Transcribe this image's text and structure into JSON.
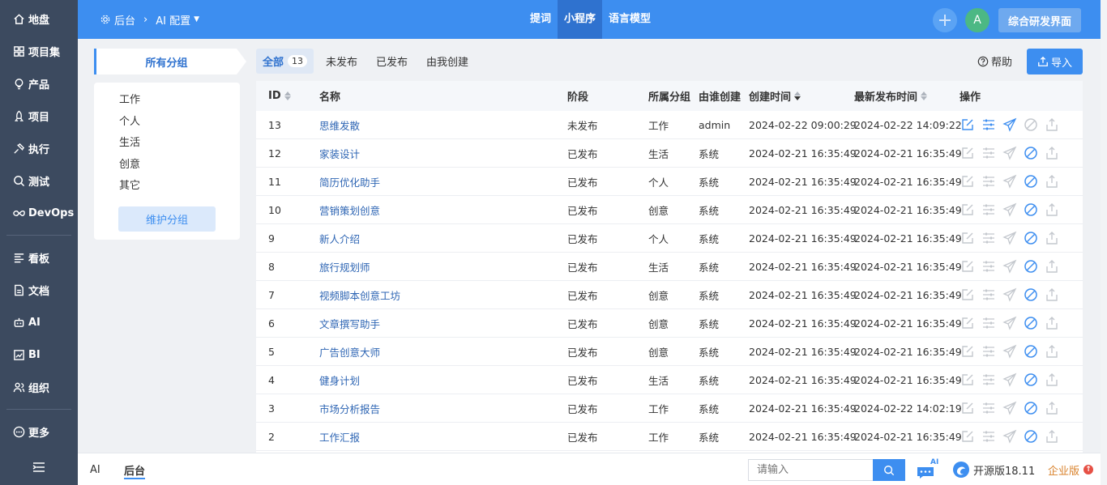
{
  "sidebar": {
    "items": [
      {
        "label": "地盘",
        "icon": "home-icon"
      },
      {
        "label": "项目集",
        "icon": "grid-icon"
      },
      {
        "label": "产品",
        "icon": "lightbulb-icon"
      },
      {
        "label": "项目",
        "icon": "rocket-icon"
      },
      {
        "label": "执行",
        "icon": "execute-icon"
      },
      {
        "label": "测试",
        "icon": "test-icon"
      },
      {
        "label": "DevOps",
        "icon": "infinity-icon"
      }
    ],
    "items2": [
      {
        "label": "看板",
        "icon": "board-icon"
      },
      {
        "label": "文档",
        "icon": "doc-icon"
      },
      {
        "label": "AI",
        "icon": "robot-icon"
      },
      {
        "label": "BI",
        "icon": "chart-icon"
      },
      {
        "label": "组织",
        "icon": "org-icon"
      }
    ],
    "more": "更多"
  },
  "header": {
    "crumb_root": "后台",
    "crumb_current": "AI 配置",
    "tabs": [
      "提词",
      "小程序",
      "语言模型"
    ],
    "active_tab": "小程序",
    "avatar_letter": "A",
    "dev_button": "综合研发界面"
  },
  "groups": {
    "title": "所有分组",
    "items": [
      "工作",
      "个人",
      "生活",
      "创意",
      "其它"
    ],
    "maintain": "维护分组"
  },
  "filters": {
    "tabs": [
      "全部",
      "未发布",
      "已发布",
      "由我创建"
    ],
    "all_count": "13",
    "help": "帮助",
    "import": "导入"
  },
  "table": {
    "headers": {
      "id": "ID",
      "name": "名称",
      "stage": "阶段",
      "group": "所属分组",
      "creator": "由谁创建",
      "created": "创建时间",
      "published": "最新发布时间",
      "ops": "操作"
    },
    "rows": [
      {
        "id": "13",
        "name": "思维发散",
        "stage": "未发布",
        "group": "工作",
        "creator": "admin",
        "created": "2024-02-22 09:00:29",
        "published": "2024-02-22 14:09:22",
        "published_state": "draft"
      },
      {
        "id": "12",
        "name": "家装设计",
        "stage": "已发布",
        "group": "生活",
        "creator": "系统",
        "created": "2024-02-21 16:35:49",
        "published": "2024-02-21 16:35:49",
        "published_state": "live"
      },
      {
        "id": "11",
        "name": "简历优化助手",
        "stage": "已发布",
        "group": "个人",
        "creator": "系统",
        "created": "2024-02-21 16:35:49",
        "published": "2024-02-21 16:35:49",
        "published_state": "live"
      },
      {
        "id": "10",
        "name": "营销策划创意",
        "stage": "已发布",
        "group": "创意",
        "creator": "系统",
        "created": "2024-02-21 16:35:49",
        "published": "2024-02-21 16:35:49",
        "published_state": "live"
      },
      {
        "id": "9",
        "name": "新人介绍",
        "stage": "已发布",
        "group": "个人",
        "creator": "系统",
        "created": "2024-02-21 16:35:49",
        "published": "2024-02-21 16:35:49",
        "published_state": "live"
      },
      {
        "id": "8",
        "name": "旅行规划师",
        "stage": "已发布",
        "group": "生活",
        "creator": "系统",
        "created": "2024-02-21 16:35:49",
        "published": "2024-02-21 16:35:49",
        "published_state": "live"
      },
      {
        "id": "7",
        "name": "视频脚本创意工坊",
        "stage": "已发布",
        "group": "创意",
        "creator": "系统",
        "created": "2024-02-21 16:35:49",
        "published": "2024-02-21 16:35:49",
        "published_state": "live"
      },
      {
        "id": "6",
        "name": "文章撰写助手",
        "stage": "已发布",
        "group": "创意",
        "creator": "系统",
        "created": "2024-02-21 16:35:49",
        "published": "2024-02-21 16:35:49",
        "published_state": "live"
      },
      {
        "id": "5",
        "name": "广告创意大师",
        "stage": "已发布",
        "group": "创意",
        "creator": "系统",
        "created": "2024-02-21 16:35:49",
        "published": "2024-02-21 16:35:49",
        "published_state": "live"
      },
      {
        "id": "4",
        "name": "健身计划",
        "stage": "已发布",
        "group": "生活",
        "creator": "系统",
        "created": "2024-02-21 16:35:49",
        "published": "2024-02-21 16:35:49",
        "published_state": "live"
      },
      {
        "id": "3",
        "name": "市场分析报告",
        "stage": "已发布",
        "group": "工作",
        "creator": "系统",
        "created": "2024-02-21 16:35:49",
        "published": "2024-02-22 14:02:19",
        "published_state": "live"
      },
      {
        "id": "2",
        "name": "工作汇报",
        "stage": "已发布",
        "group": "工作",
        "creator": "系统",
        "created": "2024-02-21 16:35:49",
        "published": "2024-02-21 16:35:49",
        "published_state": "live"
      }
    ]
  },
  "bottom": {
    "tabs": [
      "AI",
      "后台"
    ],
    "active_tab": "后台",
    "search_placeholder": "请输入",
    "ai_badge": "AI",
    "version": "开源版18.11",
    "edition": "企业版",
    "edition_badge": "↑"
  },
  "colors": {
    "primary": "#3d8ef0",
    "sidebar": "#3c4a5f",
    "link": "#2f66b4",
    "disabled_icon": "#c4c8ce"
  }
}
